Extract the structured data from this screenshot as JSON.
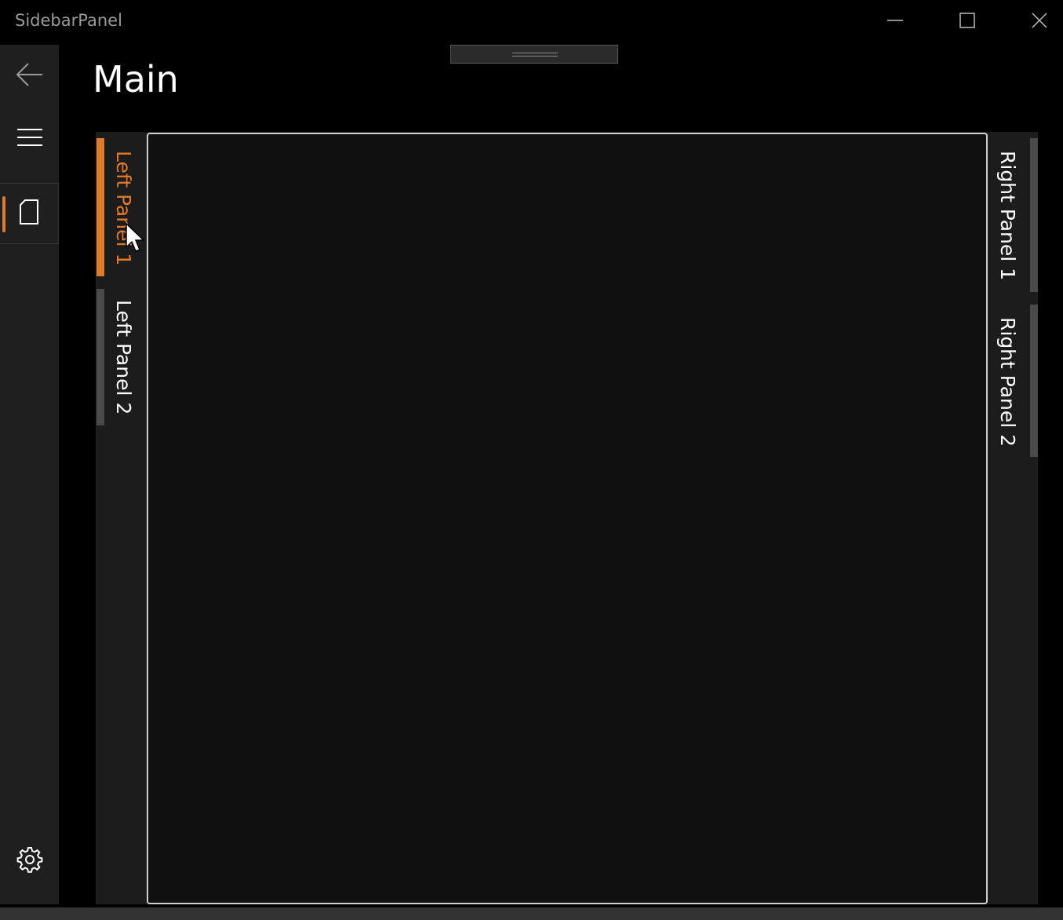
{
  "window": {
    "title": "SidebarPanel",
    "minimize_icon": "minimize-icon",
    "maximize_icon": "maximize-icon",
    "close_icon": "close-icon"
  },
  "nav": {
    "back_icon": "back-arrow-icon",
    "menu_icon": "hamburger-menu-icon",
    "page_icon": "document-icon",
    "settings_icon": "gear-icon"
  },
  "page": {
    "title": "Main"
  },
  "left_tabs": [
    {
      "label": "Left Panel 1",
      "selected": true
    },
    {
      "label": "Left Panel 2",
      "selected": false
    }
  ],
  "right_tabs": [
    {
      "label": "Right Panel 1",
      "selected": false
    },
    {
      "label": "Right Panel 2",
      "selected": false
    }
  ],
  "colors": {
    "accent": "#E07A2A",
    "background": "#000000",
    "pane": "#1F1F1F",
    "panel": "#101010",
    "panel_border": "#CFCFCF",
    "tab_inactive": "#4A4A4A"
  }
}
